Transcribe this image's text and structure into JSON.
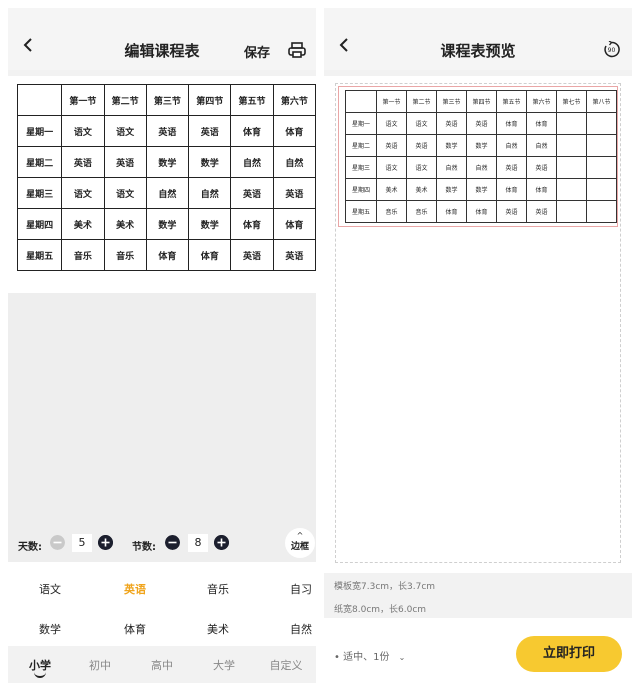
{
  "left": {
    "title": "编辑课程表",
    "save_label": "保存",
    "table": {
      "header": [
        "",
        "第一节",
        "第二节",
        "第三节",
        "第四节",
        "第五节",
        "第六节"
      ],
      "rows": [
        [
          "星期一",
          "语文",
          "语文",
          "英语",
          "英语",
          "体育",
          "体育"
        ],
        [
          "星期二",
          "英语",
          "英语",
          "数学",
          "数学",
          "自然",
          "自然"
        ],
        [
          "星期三",
          "语文",
          "语文",
          "自然",
          "自然",
          "英语",
          "英语"
        ],
        [
          "星期四",
          "美术",
          "美术",
          "数学",
          "数学",
          "体育",
          "体育"
        ],
        [
          "星期五",
          "音乐",
          "音乐",
          "体育",
          "体育",
          "英语",
          "英语"
        ]
      ]
    },
    "controls": {
      "days_label": "天数:",
      "days_value": "5",
      "periods_label": "节数:",
      "periods_value": "8",
      "border_label": "边框",
      "border_caret": "^"
    },
    "subjects": [
      "语文",
      "英语",
      "音乐",
      "自习",
      "数学",
      "体育",
      "美术",
      "自然"
    ],
    "active_subject": "英语",
    "levels": [
      "小学",
      "初中",
      "高中",
      "大学",
      "自定义"
    ],
    "active_level": "小学"
  },
  "right": {
    "title": "课程表预览",
    "table": {
      "header": [
        "",
        "第一节",
        "第二节",
        "第三节",
        "第四节",
        "第五节",
        "第六节",
        "第七节",
        "第八节"
      ],
      "rows": [
        [
          "星期一",
          "语文",
          "语文",
          "英语",
          "英语",
          "体育",
          "体育",
          "",
          ""
        ],
        [
          "星期二",
          "英语",
          "英语",
          "数学",
          "数学",
          "自然",
          "自然",
          "",
          ""
        ],
        [
          "星期三",
          "语文",
          "语文",
          "自然",
          "自然",
          "英语",
          "英语",
          "",
          ""
        ],
        [
          "星期四",
          "美术",
          "美术",
          "数学",
          "数学",
          "体育",
          "体育",
          "",
          ""
        ],
        [
          "星期五",
          "音乐",
          "音乐",
          "体育",
          "体育",
          "英语",
          "英语",
          "",
          ""
        ]
      ]
    },
    "template_size": "模板宽7.3cm，长3.7cm",
    "paper_size": "纸宽8.0cm，长6.0cm",
    "copies_label": "• 适中、1份",
    "print_label": "立即打印"
  },
  "colors": {
    "accent_yellow": "#f7c930",
    "active_subject": "#f0a41c",
    "print_zone_border": "#e9a6a6"
  },
  "icons": [
    "back-icon",
    "printer-icon",
    "rotate-90-icon",
    "minus-circle-icon",
    "plus-circle-icon",
    "chevron-up-icon",
    "chevron-down-icon"
  ]
}
